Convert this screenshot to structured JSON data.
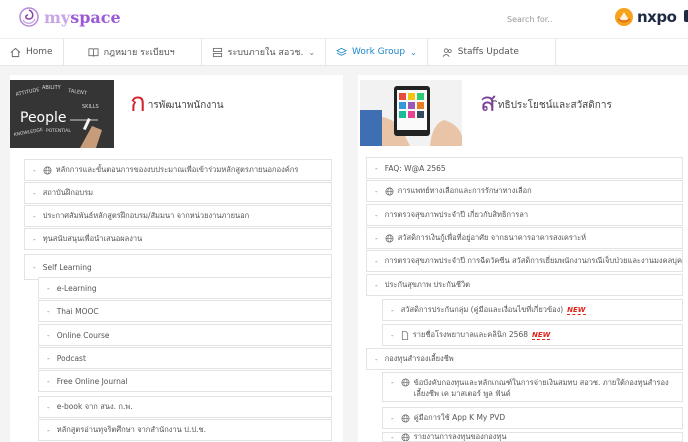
{
  "brand": {
    "logo_my": "my",
    "logo_space": "space",
    "search_placeholder": "Search for..",
    "partner_logo_text": "nxpo"
  },
  "colors": {
    "accent": "#1b86c9",
    "brand_purple": "#9b59d6",
    "title_red": "#d2232a",
    "title_purple": "#7b3f98",
    "new_badge": "#e2231a"
  },
  "nav": [
    {
      "label": "Home",
      "icon": "home-icon"
    },
    {
      "label": "กฎหมาย ระเบียบฯ",
      "icon": "book-icon"
    },
    {
      "label": "ระบบภายใน สอวช.",
      "icon": "server-icon",
      "dropdown": true
    },
    {
      "label": "Work Group",
      "icon": "layers-icon",
      "dropdown": true,
      "active": true
    },
    {
      "label": "Staffs Update",
      "icon": "users-icon"
    }
  ],
  "left": {
    "hero_image_words": [
      "ATTITUDE",
      "ABILITY",
      "TALENT",
      "SKILLS",
      "People",
      "KNOWLEDGE",
      "POTENTIAL"
    ],
    "title_initial": "ก",
    "title_rest": "ารพัฒนาพนักงาน",
    "items": [
      {
        "label": "หลักการและขั้นตอนการของงบประมาณเพื่อเข้าร่วมหลักสูตรภายนอกองค์กร",
        "icon": "globe-icon"
      },
      {
        "label": "สถาบันฝึกอบรม"
      },
      {
        "label": "ประกาศสัมพันธ์หลักสูตรฝึกอบรม/สัมมนา จากหน่วยงานภายนอก"
      },
      {
        "label": "ทุนสนับสนุนเพื่อนำเสนอผลงาน"
      },
      {
        "label": "Self Learning"
      }
    ],
    "sub_items": [
      {
        "label": "e-Learning"
      },
      {
        "label": "Thai MOOC"
      },
      {
        "label": "Online Course"
      },
      {
        "label": "Podcast"
      },
      {
        "label": "Free Online Journal"
      },
      {
        "label": "e-book จาก สนง. ก.พ."
      },
      {
        "label": "หลักสูตรอ่านทุจริตศึกษา จากสำนักงาน ป.ป.ช."
      }
    ]
  },
  "right": {
    "title_initial": "ส",
    "title_rest": "ิทธิประโยชน์และสวัสดิการ",
    "items": [
      {
        "label": "FAQ: W@A 2565"
      },
      {
        "label": "การแพทย์ทางเลือกและการรักษาทางเลือก",
        "icon": "globe-icon"
      },
      {
        "label": "การตรวจสุขภาพประจำปี เกี่ยวกับสิทธิการลา"
      },
      {
        "label": "สวัสดิการเงินกู้เพื่อที่อยู่อาศัย จากธนาคารอาคารสงเคราะห์",
        "icon": "globe-icon"
      },
      {
        "label": "การตรวจสุขภาพประจำปี การฉีดวัคซีน สวัสดิการเยี่ยมพนักงานกรณีเจ็บป่วยและงานมงคลบุคคล"
      },
      {
        "label": "ประกันสุขภาพ ประกันชีวิต"
      }
    ],
    "sub_items_1": [
      {
        "label": "สวัสดิการประกันกลุ่ม (คู่มือและเงื่อนไขที่เกี่ยวข้อง)",
        "badge": "NEW"
      },
      {
        "label": "รายชื่อโรงพยาบาลและคลินิก 2568",
        "icon": "doc-icon",
        "badge": "NEW"
      }
    ],
    "item_fund": {
      "label": "กองทุนสำรองเลี้ยงชีพ"
    },
    "sub_items_2": [
      {
        "label": "ข้อบังคับกองทุนและหลักเกณฑ์ในการจ่ายเงินสมทบ สอวช. ภายใต้กองทุนสำรองเลี้ยงชีพ เค มาสเตอร์ พูล ฟันด์",
        "icon": "globe-icon"
      },
      {
        "label": "คู่มือการใช้ App K My PVD",
        "icon": "globe-icon"
      },
      {
        "label": "รายงานการลงทุนของกองทุน",
        "icon": "globe-icon"
      }
    ]
  }
}
